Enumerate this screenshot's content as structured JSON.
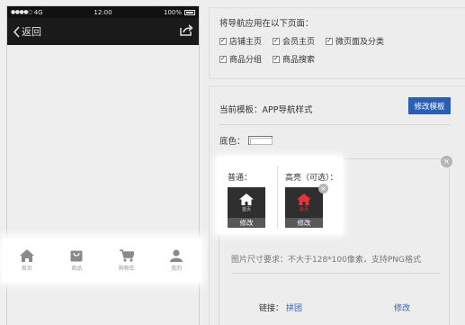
{
  "phone": {
    "status": {
      "signal_dots": "●●●●○",
      "carrier": "4G",
      "time": "12:00",
      "battery_pct": "100%"
    },
    "nav": {
      "back_label": "返回",
      "share_icon": "share-icon"
    },
    "tabbar": [
      {
        "label": "首页",
        "icon": "home-icon"
      },
      {
        "label": "商品",
        "icon": "shopping-bag-icon"
      },
      {
        "label": "购物车",
        "icon": "cart-icon"
      },
      {
        "label": "我的",
        "icon": "user-icon"
      }
    ]
  },
  "apply_section": {
    "title": "将导航应用在以下页面：",
    "options": [
      {
        "label": "店铺主页",
        "checked": true
      },
      {
        "label": "会员主页",
        "checked": true
      },
      {
        "label": "微页面及分类",
        "checked": true
      },
      {
        "label": "商品分组",
        "checked": true
      },
      {
        "label": "商品搜索",
        "checked": true
      }
    ]
  },
  "template": {
    "current_label": "当前模板：",
    "current_value": "APP导航样式",
    "edit_button": "修改模板",
    "bgcolor_label": "底色：",
    "bgcolor_value": "#ffffff"
  },
  "nav_item": {
    "normal_label": "普通：",
    "highlight_label": "高亮（可选）：",
    "icon_caption": "首页",
    "edit_label": "修改",
    "close_glyph": "×",
    "size_hint": "图片尺寸要求：不大于128*100像素，支持PNG格式",
    "link_label": "链接：",
    "link_value": "拼团",
    "link_edit": "修改"
  },
  "colors": {
    "accent": "#2b5fb3",
    "highlight_icon": "#e8333a",
    "normal_icon": "#ffffff"
  }
}
